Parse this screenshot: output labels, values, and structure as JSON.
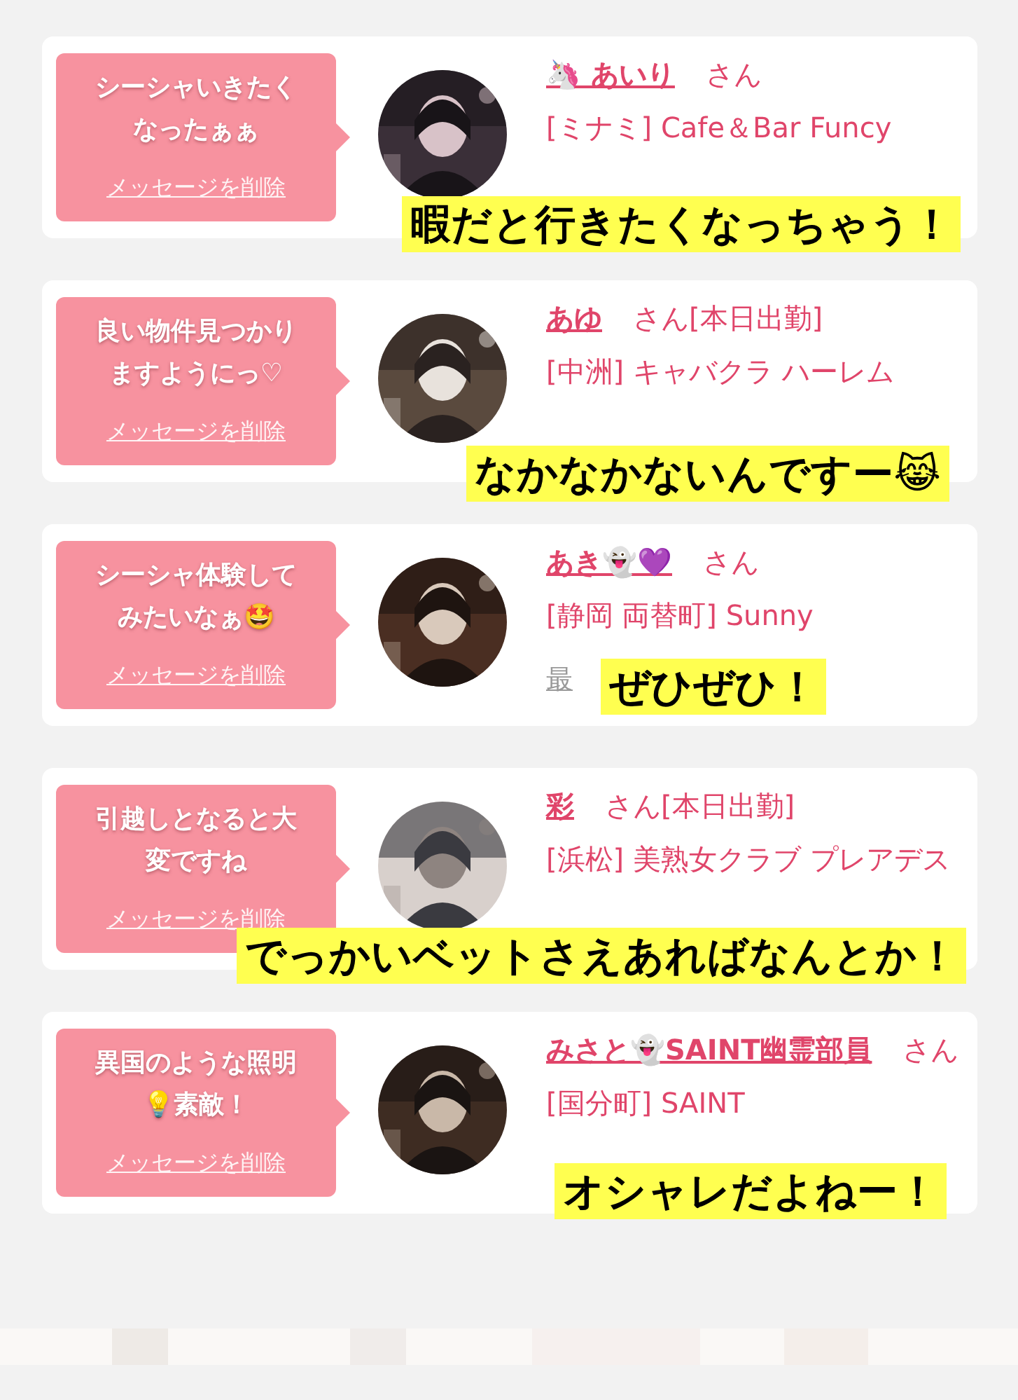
{
  "messages": [
    {
      "message": "シーシャいきたくなったぁぁ",
      "delete_link": "メッセージを削除",
      "name": "🦄 あいり",
      "honorific": "さん",
      "shop": "[ミナミ] Cafe＆Bar Funcy",
      "caption": "暇だと行きたくなっちゃう！"
    },
    {
      "message": "良い物件見つかりますようにっ♡",
      "delete_link": "メッセージを削除",
      "name": "あゆ",
      "honorific": "さん",
      "status": "[本日出勤]",
      "shop": "[中洲] キャバクラ ハーレム",
      "caption": "なかなかないんですー😹"
    },
    {
      "message": "シーシャ体験してみたいなぁ🤩",
      "delete_link": "メッセージを削除",
      "name": "あき👻💜",
      "honorific": "さん",
      "shop": "[静岡 両替町] Sunny",
      "blog_link": "最",
      "caption": "ぜひぜひ！"
    },
    {
      "message": "引越しとなると大変ですね",
      "delete_link": "メッセージを削除",
      "name": "彩",
      "honorific": "さん",
      "status": "[本日出勤]",
      "shop": "[浜松] 美熟女クラブ プレアデス",
      "caption": "でっかいベットさえあればなんとか！"
    },
    {
      "message": "異国のような照明💡素敵！",
      "delete_link": "メッセージを削除",
      "name": "みさと👻SAINT幽霊部員",
      "honorific": "さん",
      "shop": "[国分町] SAINT",
      "caption": "オシャレだよねー！"
    }
  ]
}
